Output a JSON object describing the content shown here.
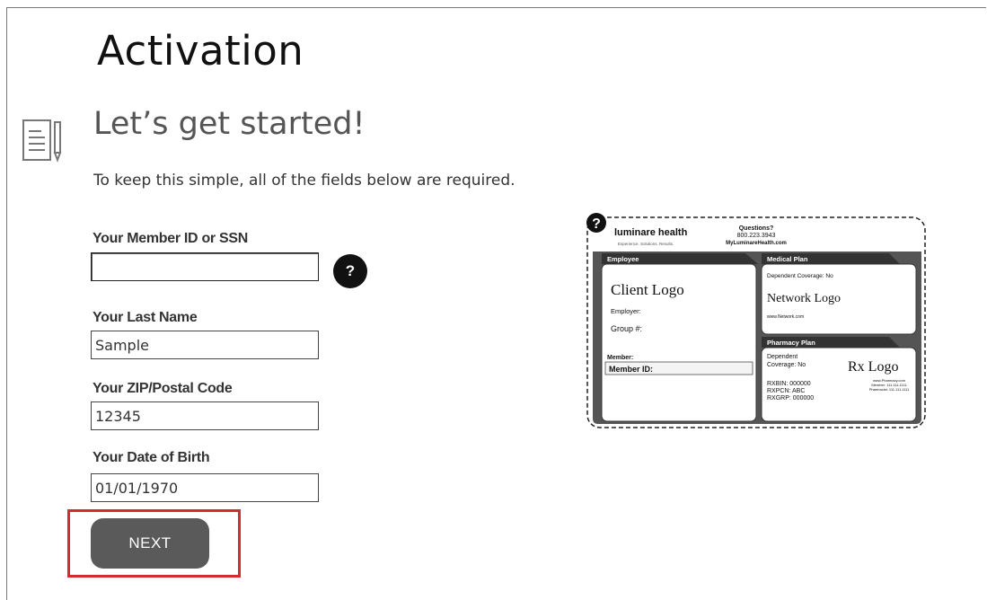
{
  "page": {
    "title": "Activation",
    "subtitle": "Let’s get started!",
    "intro": "To keep this simple, all of the fields below are required."
  },
  "form": {
    "member_id": {
      "label": "Your Member ID or SSN",
      "value": ""
    },
    "help_button": "?",
    "last_name": {
      "label": "Your Last Name",
      "value": "Sample"
    },
    "zip": {
      "label": "Your ZIP/Postal Code",
      "value": "12345"
    },
    "dob": {
      "label": "Your Date of Birth",
      "value": "01/01/1970"
    },
    "next_label": "NEXT"
  },
  "card": {
    "brand": "luminare health",
    "tagline": "Experience. Solutions. Results.",
    "questions_label": "Questions?",
    "phone": "800.223.3943",
    "website": "MyLuminareHealth.com",
    "employee_header": "Employee",
    "client_logo": "Client Logo",
    "employer_label": "Employer:",
    "group_label": "Group #:",
    "member_label": "Member:",
    "member_id_label": "Member ID:",
    "medical_header": "Medical Plan",
    "dependent_coverage": "Dependent Coverage: No",
    "network_logo": "Network Logo",
    "network_url": "www.Network.com",
    "pharmacy_header": "Pharmacy Plan",
    "pharm_dep_line1": "Dependent",
    "pharm_dep_line2": "Coverage: No",
    "rx_logo": "Rx Logo",
    "rxbin": "RXBIN:  000000",
    "rxpcn": "RXPCN:  ABC",
    "rxgrp": "RXGRP:  000000",
    "pharm_url": "www.Pharmacy.com",
    "pharm_member": "Member: 111.111.1111",
    "pharm_pharmacist": "Pharmacist: 111.111.1111",
    "help_marker": "?"
  }
}
